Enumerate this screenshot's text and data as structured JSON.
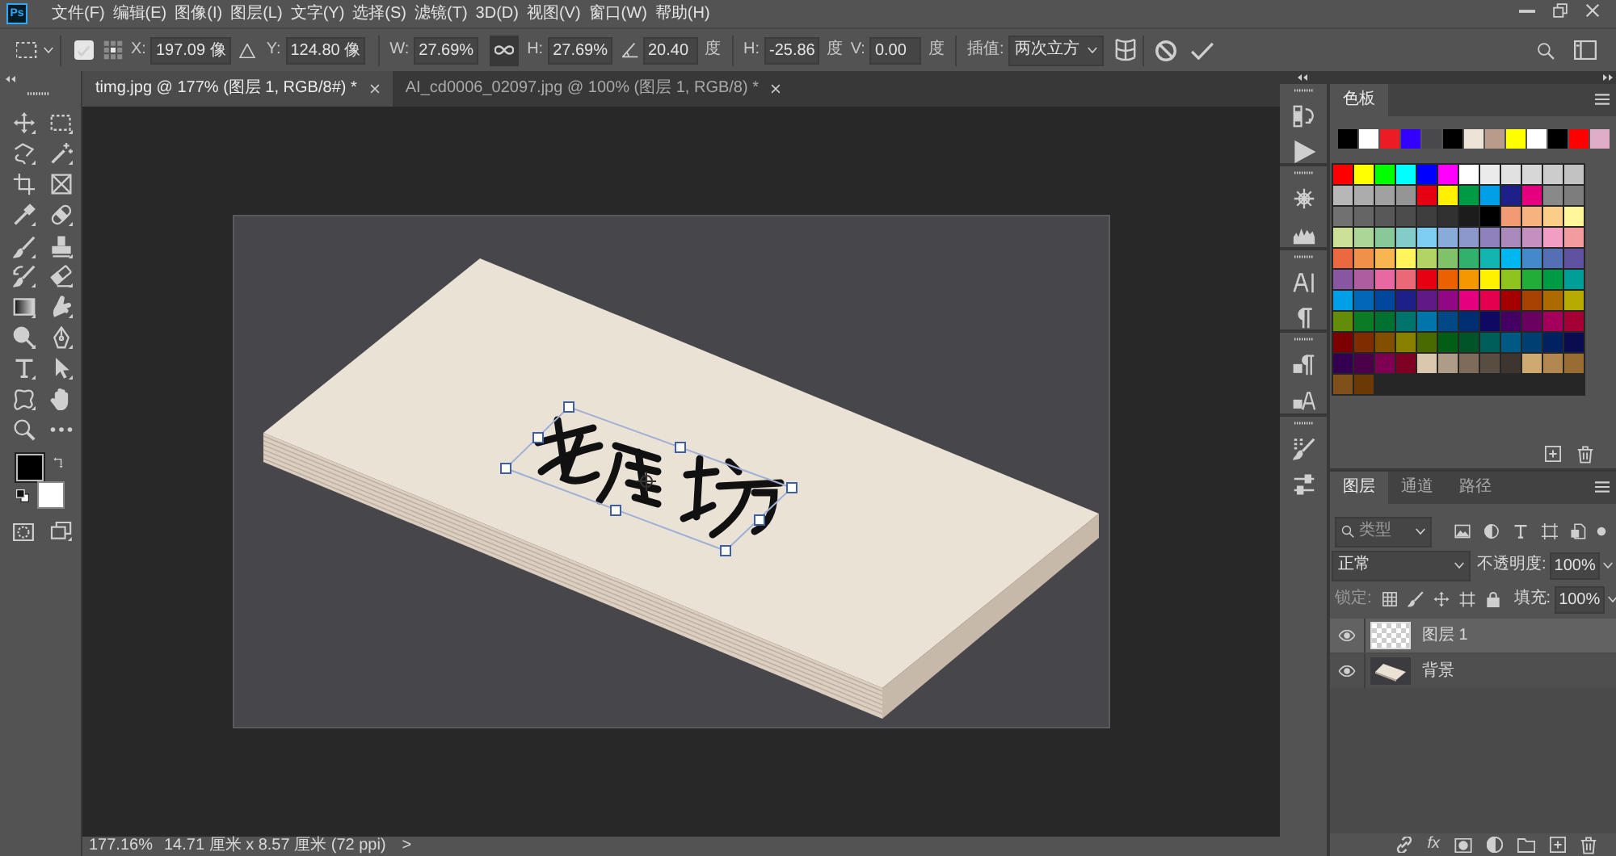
{
  "menu_bar": {
    "logo": "Ps",
    "items": [
      "文件(F)",
      "编辑(E)",
      "图像(I)",
      "图层(L)",
      "文字(Y)",
      "选择(S)",
      "滤镜(T)",
      "3D(D)",
      "视图(V)",
      "窗口(W)",
      "帮助(H)"
    ]
  },
  "options_bar": {
    "reference_point": {
      "checked": true
    },
    "position": [
      {
        "label": "X:",
        "value": "197.09 像"
      },
      {
        "label": "Y:",
        "value": "124.80 像"
      }
    ],
    "size": [
      {
        "label": "W:",
        "value": "27.69%"
      },
      {
        "label": "H:",
        "value": "27.69%"
      }
    ],
    "link": {
      "on": true
    },
    "rotation": {
      "value": "20.40",
      "unit": "度"
    },
    "skew": [
      {
        "label": "H:",
        "value": "-25.86",
        "unit": "度"
      },
      {
        "label": "V:",
        "value": "0.00",
        "unit": "度"
      }
    ],
    "interpolation": {
      "label": "插值:",
      "value": "两次立方"
    }
  },
  "tabs": [
    {
      "label": "timg.jpg @ 177% (图层 1, RGB/8#) *",
      "selected": true
    },
    {
      "label": "AI_cd0006_02097.jpg @ 100% (图层 1, RGB/8) *",
      "selected": false
    }
  ],
  "tools": {
    "colors": [
      {
        "kind": "foreground",
        "color": "#000000"
      },
      {
        "kind": "background",
        "color": "#ffffff"
      }
    ]
  },
  "swatches_panel": {
    "tabs": [
      {
        "label": "色板",
        "selected": true
      }
    ],
    "recent": [
      {
        "color": "#000000"
      },
      {
        "color": "#ffffff"
      },
      {
        "color": "#ed1c24"
      },
      {
        "color": "#3300ff"
      },
      {
        "color": "#48484d"
      },
      {
        "color": "#000000"
      },
      {
        "color": "#ede3d6"
      },
      {
        "color": "#b99b8c"
      },
      {
        "color": "#ffff00"
      },
      {
        "color": "#ffffff"
      },
      {
        "color": "#000000"
      },
      {
        "color": "#ff0000"
      },
      {
        "color": "#dfadc6"
      }
    ],
    "grid": [
      {
        "color": "#ff0000"
      },
      {
        "color": "#ffff00"
      },
      {
        "color": "#00ff00"
      },
      {
        "color": "#00ffff"
      },
      {
        "color": "#0000ff"
      },
      {
        "color": "#ff00ff"
      },
      {
        "color": "#ffffff"
      },
      {
        "color": "#ebebeb"
      },
      {
        "color": "#e1e1e1"
      },
      {
        "color": "#d7d7d7"
      },
      {
        "color": "#cccccc"
      },
      {
        "color": "#c2c2c2"
      },
      {
        "color": "#b7b7b7"
      },
      {
        "color": "#acacac"
      },
      {
        "color": "#a1a1a1"
      },
      {
        "color": "#959595"
      },
      {
        "color": "#e60012"
      },
      {
        "color": "#fff100"
      },
      {
        "color": "#009944"
      },
      {
        "color": "#00a0e9"
      },
      {
        "color": "#1d2088"
      },
      {
        "color": "#e4007f"
      },
      {
        "color": "#898989"
      },
      {
        "color": "#7d7d7d"
      },
      {
        "color": "#717171"
      },
      {
        "color": "#656565"
      },
      {
        "color": "#585858"
      },
      {
        "color": "#4c4c4c"
      },
      {
        "color": "#3e3e3e"
      },
      {
        "color": "#313131"
      },
      {
        "color": "#1c1c1c"
      },
      {
        "color": "#000000"
      },
      {
        "color": "#f19a73"
      },
      {
        "color": "#f6b37f"
      },
      {
        "color": "#facd89"
      },
      {
        "color": "#fff799"
      },
      {
        "color": "#cce198"
      },
      {
        "color": "#acd598"
      },
      {
        "color": "#89c997"
      },
      {
        "color": "#84ccc9"
      },
      {
        "color": "#7ecef4"
      },
      {
        "color": "#88abda"
      },
      {
        "color": "#8c97cb"
      },
      {
        "color": "#8f82bc"
      },
      {
        "color": "#aa89bd"
      },
      {
        "color": "#c490bf"
      },
      {
        "color": "#f19ec2"
      },
      {
        "color": "#f29c9f"
      },
      {
        "color": "#eb6941"
      },
      {
        "color": "#f19149"
      },
      {
        "color": "#f8b551"
      },
      {
        "color": "#fff45c"
      },
      {
        "color": "#b3d465"
      },
      {
        "color": "#80c269"
      },
      {
        "color": "#32b16c"
      },
      {
        "color": "#13b5b1"
      },
      {
        "color": "#00b7ee"
      },
      {
        "color": "#448aca"
      },
      {
        "color": "#556fb5"
      },
      {
        "color": "#5f52a0"
      },
      {
        "color": "#8957a1"
      },
      {
        "color": "#ae5da1"
      },
      {
        "color": "#ea68a2"
      },
      {
        "color": "#eb6877"
      },
      {
        "color": "#e60012"
      },
      {
        "color": "#eb6100"
      },
      {
        "color": "#f39800"
      },
      {
        "color": "#fff100"
      },
      {
        "color": "#8fc31f"
      },
      {
        "color": "#22ac38"
      },
      {
        "color": "#009944"
      },
      {
        "color": "#009e96"
      },
      {
        "color": "#00a0e9"
      },
      {
        "color": "#0068b7"
      },
      {
        "color": "#00479d"
      },
      {
        "color": "#1d2088"
      },
      {
        "color": "#601986"
      },
      {
        "color": "#920783"
      },
      {
        "color": "#e4007f"
      },
      {
        "color": "#e5004f"
      },
      {
        "color": "#a40000"
      },
      {
        "color": "#a84200"
      },
      {
        "color": "#ac6a00"
      },
      {
        "color": "#b7aa00"
      },
      {
        "color": "#638c0b"
      },
      {
        "color": "#097c25"
      },
      {
        "color": "#007130"
      },
      {
        "color": "#00736d"
      },
      {
        "color": "#0075a9"
      },
      {
        "color": "#004986"
      },
      {
        "color": "#002e73"
      },
      {
        "color": "#100964"
      },
      {
        "color": "#440062"
      },
      {
        "color": "#6a005f"
      },
      {
        "color": "#a4005b"
      },
      {
        "color": "#a40035"
      },
      {
        "color": "#7d0000"
      },
      {
        "color": "#7f2d00"
      },
      {
        "color": "#814f00"
      },
      {
        "color": "#8a8000"
      },
      {
        "color": "#486a00"
      },
      {
        "color": "#005e15"
      },
      {
        "color": "#005428"
      },
      {
        "color": "#005e58"
      },
      {
        "color": "#005982"
      },
      {
        "color": "#003f71"
      },
      {
        "color": "#002263"
      },
      {
        "color": "#0b0b50"
      },
      {
        "color": "#32004f"
      },
      {
        "color": "#4a0049"
      },
      {
        "color": "#7e0050"
      },
      {
        "color": "#7e0023"
      },
      {
        "color": "#d9c8ae"
      },
      {
        "color": "#ae9c86"
      },
      {
        "color": "#7e6b5a"
      },
      {
        "color": "#594c41"
      },
      {
        "color": "#3e3430"
      },
      {
        "color": "#cfa972"
      },
      {
        "color": "#b28850"
      },
      {
        "color": "#996c33"
      },
      {
        "color": "#7f5019"
      },
      {
        "color": "#6a3906"
      }
    ]
  },
  "layers_panel": {
    "tabs": [
      {
        "label": "图层",
        "selected": true
      },
      {
        "label": "通道",
        "selected": false
      },
      {
        "label": "路径",
        "selected": false
      }
    ],
    "filter_kind": "类型",
    "blend_mode": "正常",
    "opacity": {
      "label": "不透明度:",
      "value": "100%"
    },
    "lock_label": "锁定:",
    "fill": {
      "label": "填充:",
      "value": "100%"
    },
    "layers": [
      {
        "name": "图层 1",
        "kind": "transparent",
        "visible": true,
        "selected": true
      },
      {
        "name": "背景",
        "kind": "photo",
        "visible": true,
        "selected": false
      }
    ],
    "effects_button": "fx"
  },
  "status_bar": {
    "zoom": "177.16%",
    "document_size": "14.71 厘米 x 8.57 厘米 (72 ppi)",
    "arrow": ">"
  }
}
